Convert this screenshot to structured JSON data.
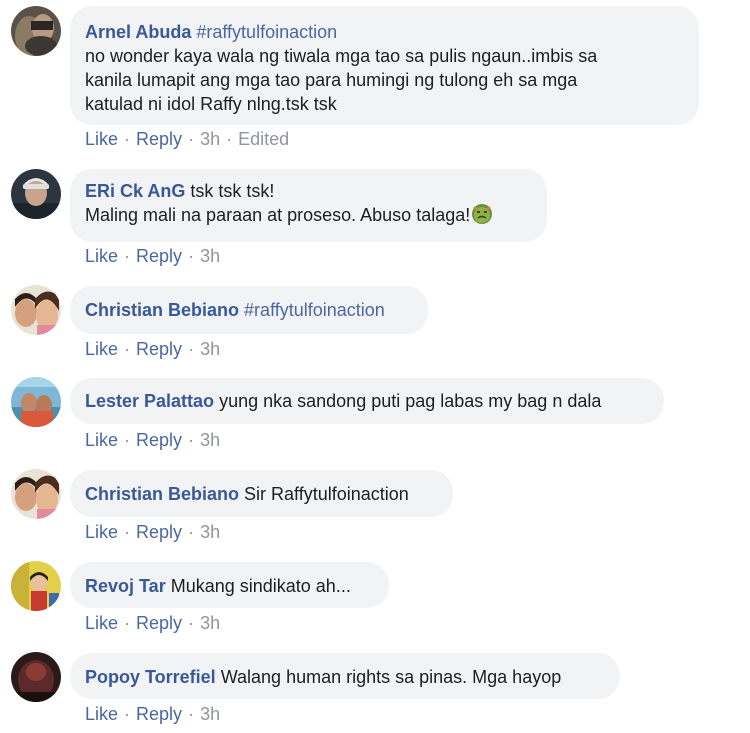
{
  "actions": {
    "like_label": "Like",
    "reply_label": "Reply",
    "separator": "·"
  },
  "comments": [
    {
      "author": "Arnel Abuda",
      "hashtag": "#raffytulfoinaction",
      "text_lines": [
        "no wonder kaya wala ng tiwala mga tao sa pulis ngaun..imbis sa",
        "kanila lumapit ang mga tao para humingi ng tulong eh sa mga",
        "katulad ni idol Raffy nlng.tsk tsk"
      ],
      "time": "3h",
      "edited": "Edited"
    },
    {
      "author": "ERi Ck AnG",
      "text": "tsk tsk tsk!",
      "text_line2": "Maling mali na paraan at proseso. Abuso talaga!",
      "emoji": "angry-face-emoji",
      "time": "3h"
    },
    {
      "author": "Christian Bebiano",
      "hashtag": "#raffytulfoinaction",
      "time": "3h"
    },
    {
      "author": "Lester Palattao",
      "text": "yung nka sandong puti pag labas my bag n dala",
      "time": "3h"
    },
    {
      "author": "Christian Bebiano",
      "text": "Sir Raffytulfoinaction",
      "time": "3h"
    },
    {
      "author": "Revoj Tar",
      "text": "Mukang sindikato ah...",
      "time": "3h"
    },
    {
      "author": "Popoy Torrefiel",
      "text": "Walang human rights sa pinas. Mga hayop",
      "time": "3h"
    }
  ],
  "colors": {
    "author": "#385898",
    "bubble": "#f2f3f5",
    "action_link": "#4b67a1",
    "meta": "#90949c"
  }
}
